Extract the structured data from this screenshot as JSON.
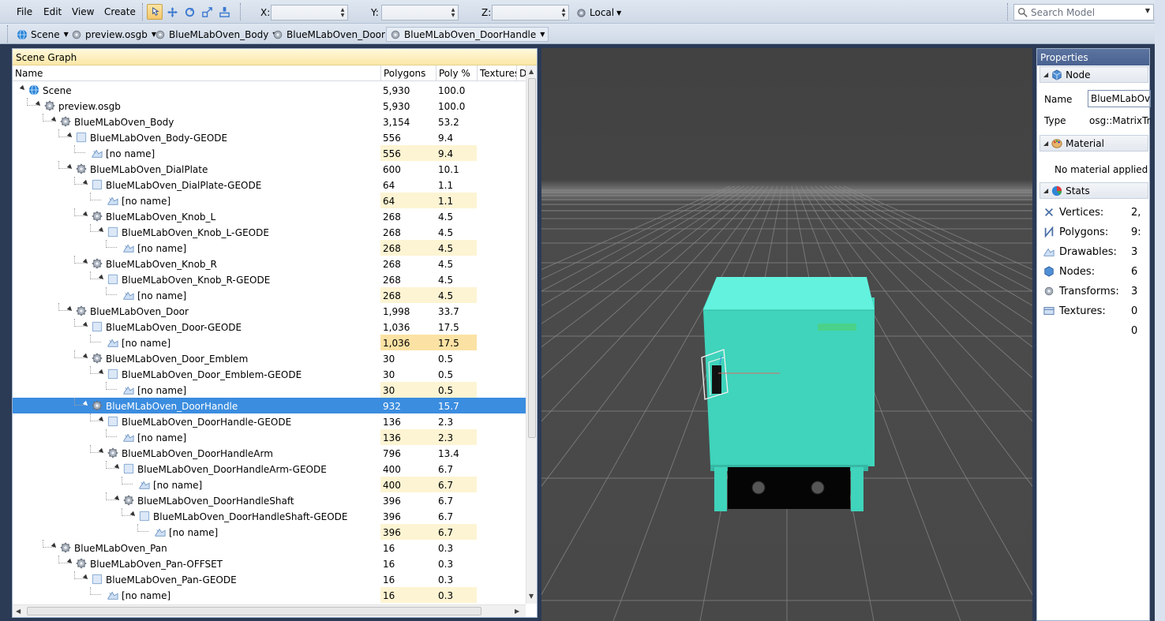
{
  "menu": {
    "file": "File",
    "edit": "Edit",
    "view": "View",
    "create": "Create"
  },
  "toolbar": {
    "x_label": "X:",
    "y_label": "Y:",
    "z_label": "Z:",
    "x_value": "",
    "y_value": "",
    "z_value": "",
    "space": "Local",
    "search_placeholder": "Search Model"
  },
  "breadcrumbs": [
    "Scene",
    "preview.osgb",
    "BlueMLabOven_Body",
    "BlueMLabOven_Door",
    "BlueMLabOven_DoorHandle"
  ],
  "scene_graph": {
    "title": "Scene Graph",
    "columns": {
      "name": "Name",
      "polygons": "Polygons",
      "poly_pct": "Poly %",
      "textures": "Textures",
      "d": "D"
    },
    "rows": [
      {
        "name": "Scene",
        "polygons": "5,930",
        "pct": "100.0",
        "depth": 0,
        "icon": "globe-icon",
        "expanded": true
      },
      {
        "name": "preview.osgb",
        "polygons": "5,930",
        "pct": "100.0",
        "depth": 1,
        "icon": "gear-icon",
        "expanded": true
      },
      {
        "name": "BlueMLabOven_Body",
        "polygons": "3,154",
        "pct": "53.2",
        "depth": 2,
        "icon": "gear-icon",
        "expanded": true
      },
      {
        "name": "BlueMLabOven_Body-GEODE",
        "polygons": "556",
        "pct": "9.4",
        "depth": 3,
        "icon": "geode-icon",
        "expanded": true
      },
      {
        "name": "[no name]",
        "polygons": "556",
        "pct": "9.4",
        "depth": 4,
        "icon": "drawable-icon",
        "highlight": true
      },
      {
        "name": "BlueMLabOven_DialPlate",
        "polygons": "600",
        "pct": "10.1",
        "depth": 3,
        "icon": "gear-icon",
        "expanded": true
      },
      {
        "name": "BlueMLabOven_DialPlate-GEODE",
        "polygons": "64",
        "pct": "1.1",
        "depth": 4,
        "icon": "geode-icon",
        "expanded": true
      },
      {
        "name": "[no name]",
        "polygons": "64",
        "pct": "1.1",
        "depth": 5,
        "icon": "drawable-icon",
        "highlight": true
      },
      {
        "name": "BlueMLabOven_Knob_L",
        "polygons": "268",
        "pct": "4.5",
        "depth": 4,
        "icon": "gear-icon",
        "expanded": true
      },
      {
        "name": "BlueMLabOven_Knob_L-GEODE",
        "polygons": "268",
        "pct": "4.5",
        "depth": 5,
        "icon": "geode-icon",
        "expanded": true
      },
      {
        "name": "[no name]",
        "polygons": "268",
        "pct": "4.5",
        "depth": 6,
        "icon": "drawable-icon",
        "highlight": true
      },
      {
        "name": "BlueMLabOven_Knob_R",
        "polygons": "268",
        "pct": "4.5",
        "depth": 4,
        "icon": "gear-icon",
        "expanded": true
      },
      {
        "name": "BlueMLabOven_Knob_R-GEODE",
        "polygons": "268",
        "pct": "4.5",
        "depth": 5,
        "icon": "geode-icon",
        "expanded": true
      },
      {
        "name": "[no name]",
        "polygons": "268",
        "pct": "4.5",
        "depth": 6,
        "icon": "drawable-icon",
        "highlight": true
      },
      {
        "name": "BlueMLabOven_Door",
        "polygons": "1,998",
        "pct": "33.7",
        "depth": 3,
        "icon": "gear-icon",
        "expanded": true
      },
      {
        "name": "BlueMLabOven_Door-GEODE",
        "polygons": "1,036",
        "pct": "17.5",
        "depth": 4,
        "icon": "geode-icon",
        "expanded": true
      },
      {
        "name": "[no name]",
        "polygons": "1,036",
        "pct": "17.5",
        "depth": 5,
        "icon": "drawable-icon",
        "highlight": true,
        "strong": true
      },
      {
        "name": "BlueMLabOven_Door_Emblem",
        "polygons": "30",
        "pct": "0.5",
        "depth": 4,
        "icon": "gear-icon",
        "expanded": true
      },
      {
        "name": "BlueMLabOven_Door_Emblem-GEODE",
        "polygons": "30",
        "pct": "0.5",
        "depth": 5,
        "icon": "geode-icon",
        "expanded": true
      },
      {
        "name": "[no name]",
        "polygons": "30",
        "pct": "0.5",
        "depth": 6,
        "icon": "drawable-icon",
        "highlight": true
      },
      {
        "name": "BlueMLabOven_DoorHandle",
        "polygons": "932",
        "pct": "15.7",
        "depth": 4,
        "icon": "gear-icon",
        "expanded": true,
        "selected": true
      },
      {
        "name": "BlueMLabOven_DoorHandle-GEODE",
        "polygons": "136",
        "pct": "2.3",
        "depth": 5,
        "icon": "geode-icon",
        "expanded": true
      },
      {
        "name": "[no name]",
        "polygons": "136",
        "pct": "2.3",
        "depth": 6,
        "icon": "drawable-icon",
        "highlight": true
      },
      {
        "name": "BlueMLabOven_DoorHandleArm",
        "polygons": "796",
        "pct": "13.4",
        "depth": 5,
        "icon": "gear-icon",
        "expanded": true
      },
      {
        "name": "BlueMLabOven_DoorHandleArm-GEODE",
        "polygons": "400",
        "pct": "6.7",
        "depth": 6,
        "icon": "geode-icon",
        "expanded": true
      },
      {
        "name": "[no name]",
        "polygons": "400",
        "pct": "6.7",
        "depth": 7,
        "icon": "drawable-icon",
        "highlight": true
      },
      {
        "name": "BlueMLabOven_DoorHandleShaft",
        "polygons": "396",
        "pct": "6.7",
        "depth": 6,
        "icon": "gear-icon",
        "expanded": true
      },
      {
        "name": "BlueMLabOven_DoorHandleShaft-GEODE",
        "polygons": "396",
        "pct": "6.7",
        "depth": 7,
        "icon": "geode-icon",
        "expanded": true
      },
      {
        "name": "[no name]",
        "polygons": "396",
        "pct": "6.7",
        "depth": 8,
        "icon": "drawable-icon",
        "highlight": true
      },
      {
        "name": "BlueMLabOven_Pan",
        "polygons": "16",
        "pct": "0.3",
        "depth": 2,
        "icon": "gear-icon",
        "expanded": true
      },
      {
        "name": "BlueMLabOven_Pan-OFFSET",
        "polygons": "16",
        "pct": "0.3",
        "depth": 3,
        "icon": "gear-icon",
        "expanded": true
      },
      {
        "name": "BlueMLabOven_Pan-GEODE",
        "polygons": "16",
        "pct": "0.3",
        "depth": 4,
        "icon": "geode-icon",
        "expanded": true
      },
      {
        "name": "[no name]",
        "polygons": "16",
        "pct": "0.3",
        "depth": 5,
        "icon": "drawable-icon",
        "highlight": true
      }
    ]
  },
  "properties": {
    "title": "Properties",
    "node_section": "Node",
    "name_label": "Name",
    "name_value": "BlueMLabOven_DoorHandle",
    "type_label": "Type",
    "type_value": "osg::MatrixTransform",
    "material_section": "Material",
    "material_text": "No material applied",
    "stats_section": "Stats",
    "stats": [
      {
        "label": "Vertices:",
        "value": "2,",
        "icon": "vertices-icon"
      },
      {
        "label": "Polygons:",
        "value": "9:",
        "icon": "polygons-icon"
      },
      {
        "label": "Drawables:",
        "value": "3",
        "icon": "drawables-icon"
      },
      {
        "label": "Nodes:",
        "value": "6",
        "icon": "nodes-icon"
      },
      {
        "label": "Transforms:",
        "value": "3",
        "icon": "transforms-icon"
      },
      {
        "label": "Textures:",
        "value": "0",
        "icon": "textures-icon"
      },
      {
        "label": "",
        "value": "0",
        "icon": ""
      }
    ]
  },
  "colors": {
    "selection": "#3b8de0",
    "oven_body": "#3fd9c0",
    "oven_top": "#62f2de",
    "viewport_bg": "#4a4a4a"
  }
}
